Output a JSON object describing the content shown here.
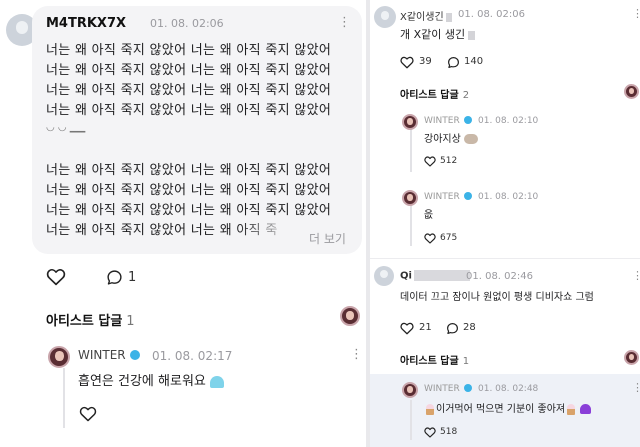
{
  "left": {
    "post": {
      "username": "M4TRKX7X",
      "timestamp": "01. 08. 02:06",
      "lines": [
        "너는 왜 아직 죽지 않았어 너는 왜 아직 죽지 않았어",
        "너는 왜 아직 죽지 않았어 너는 왜 아직 죽지 않았어",
        "너는 왜 아직 죽지 않았어 너는 왜 아직 죽지 않았어",
        "너는 왜 아직 죽지 않았어 너는 왜 아직 죽지 않았어",
        "너는 왜 아직 죽지 않았어 너는 왜 아직 죽지 않았어",
        "너는 왜 아직 죽지 않았어 너는 왜 아직 죽지 않았어",
        "너는 왜 아직 죽지 않았어 너는 왜 아직 죽지 않았어",
        "너는 왜 아직 죽지 않았어 너는 왜 아직 죽"
      ],
      "more_label": "더 보기",
      "like_count": "",
      "comment_count": "1"
    },
    "artist_replies_label": "아티스트 답글",
    "artist_replies_count": "1",
    "reply": {
      "username": "WINTER",
      "timestamp": "01. 08. 02:17",
      "text": "흡연은 건강에 해로워요"
    }
  },
  "right": {
    "post": {
      "username": "X같이생긴",
      "timestamp": "01. 08. 02:06",
      "text": "개 X같이 생긴",
      "like_count": "39",
      "comment_count": "140"
    },
    "artist_replies_label": "아티스트 답글",
    "artist_replies_count": "2",
    "replies": [
      {
        "username": "WINTER",
        "timestamp": "01. 08. 02:10",
        "text": "강아지상",
        "like_count": "512"
      },
      {
        "username": "WINTER",
        "timestamp": "01. 08. 02:10",
        "text": "읎",
        "like_count": "675"
      }
    ],
    "post2": {
      "username": "Qi",
      "timestamp": "01. 08. 02:46",
      "text": "데이터 끄고 잠이나 원없이 평생 디비자쇼 그럼",
      "like_count": "21",
      "comment_count": "28"
    },
    "artist_replies2_label": "아티스트 답글",
    "artist_replies2_count": "1",
    "reply3": {
      "username": "WINTER",
      "timestamp": "01. 08. 02:48",
      "text": "이거먹어 먹으면 기분이 좋아져",
      "like_count": "518"
    }
  },
  "icons": [
    "heart-icon",
    "comment-icon",
    "more-options-icon",
    "verified-badge-icon"
  ],
  "colors": {
    "verified": "#3bb3e7",
    "highlight": "#eef1f7"
  }
}
